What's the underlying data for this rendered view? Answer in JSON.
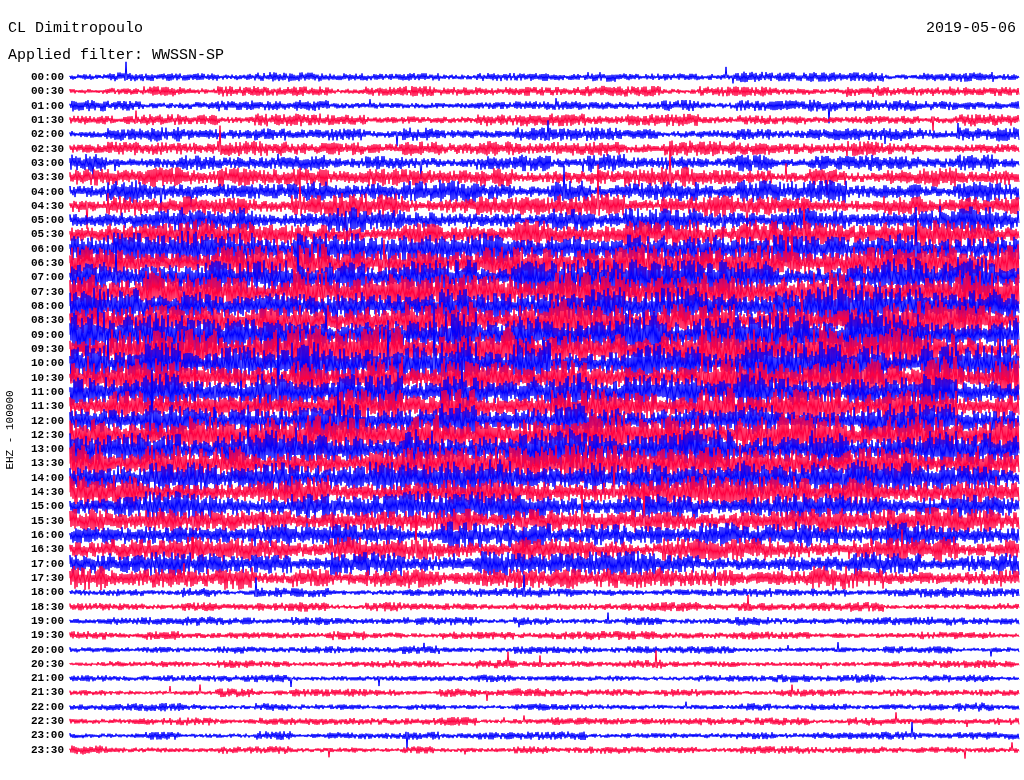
{
  "header": {
    "station": "CL Dimitropoulo",
    "date": "2019-05-06",
    "filter": "Applied filter: WWSSN-SP"
  },
  "channel_label": "EHZ - 100000",
  "rows": [
    {
      "time": "00:00"
    },
    {
      "time": "00:30"
    },
    {
      "time": "01:00"
    },
    {
      "time": "01:30"
    },
    {
      "time": "02:00"
    },
    {
      "time": "02:30"
    },
    {
      "time": "03:00"
    },
    {
      "time": "03:30"
    },
    {
      "time": "04:00"
    },
    {
      "time": "04:30"
    },
    {
      "time": "05:00"
    },
    {
      "time": "05:30"
    },
    {
      "time": "06:00"
    },
    {
      "time": "06:30"
    },
    {
      "time": "07:00"
    },
    {
      "time": "07:30"
    },
    {
      "time": "08:00"
    },
    {
      "time": "08:30"
    },
    {
      "time": "09:00"
    },
    {
      "time": "09:30"
    },
    {
      "time": "10:00"
    },
    {
      "time": "10:30"
    },
    {
      "time": "11:00"
    },
    {
      "time": "11:30"
    },
    {
      "time": "12:00"
    },
    {
      "time": "12:30"
    },
    {
      "time": "13:00"
    },
    {
      "time": "13:30"
    },
    {
      "time": "14:00"
    },
    {
      "time": "14:30"
    },
    {
      "time": "15:00"
    },
    {
      "time": "15:30"
    },
    {
      "time": "16:00"
    },
    {
      "time": "16:30"
    },
    {
      "time": "17:00"
    },
    {
      "time": "17:30"
    },
    {
      "time": "18:00"
    },
    {
      "time": "18:30"
    },
    {
      "time": "19:00"
    },
    {
      "time": "19:30"
    },
    {
      "time": "20:00"
    },
    {
      "time": "20:30"
    },
    {
      "time": "21:00"
    },
    {
      "time": "21:30"
    },
    {
      "time": "22:00"
    },
    {
      "time": "22:30"
    },
    {
      "time": "23:00"
    },
    {
      "time": "23:30"
    }
  ]
}
